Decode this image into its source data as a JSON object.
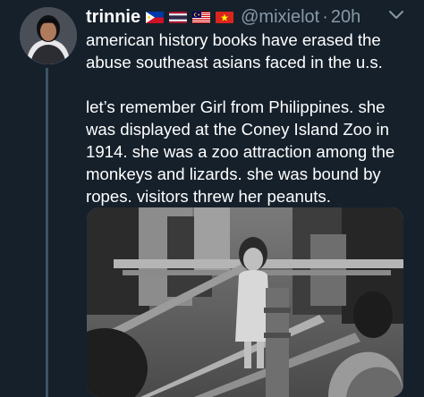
{
  "tweet": {
    "author_name": "trinnie",
    "handle": "@mixielot",
    "separator": "·",
    "time": "20h",
    "flags": [
      "flag-philippines-icon",
      "flag-thailand-icon",
      "flag-malaysia-icon",
      "flag-vietnam-icon"
    ],
    "text_paragraphs": [
      "american history books have erased the abuse southeast asians faced in the u.s.",
      "let’s remember Girl from Philippines. she was displayed at the Coney Island Zoo in 1914. she was a zoo attraction among the monkeys and lizards. she was bound by ropes. visitors threw her peanuts."
    ],
    "media_icon": "historical-photo"
  },
  "colors": {
    "background": "#15202b",
    "text": "#ffffff",
    "muted": "#8899a6",
    "thread_line": "#3d5466"
  }
}
